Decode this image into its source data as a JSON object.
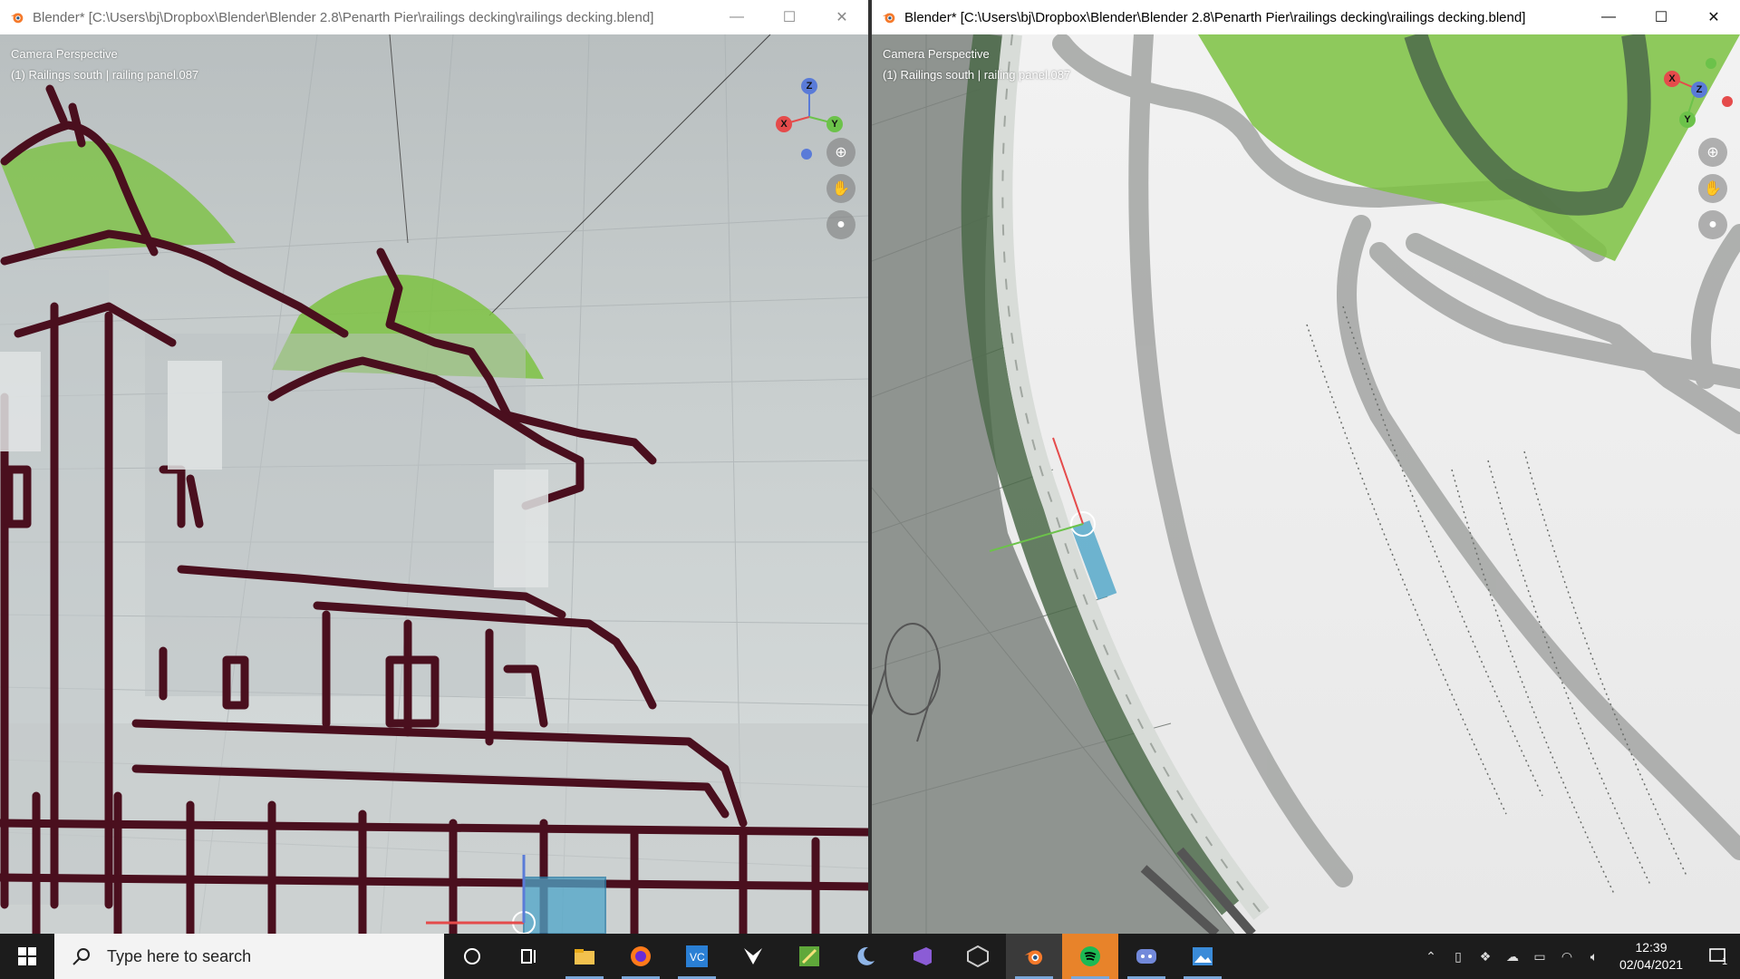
{
  "windows": [
    {
      "title": "Blender* [C:\\Users\\bj\\Dropbox\\Blender\\Blender 2.8\\Penarth Pier\\railings decking\\railings decking.blend]",
      "view_mode": "Camera Perspective",
      "selection_info": "(1) Railings south | railing panel.087",
      "minimize": "—",
      "maximize": "☐",
      "close": "✕"
    },
    {
      "title": "Blender* [C:\\Users\\bj\\Dropbox\\Blender\\Blender 2.8\\Penarth Pier\\railings decking\\railings decking.blend]",
      "view_mode": "Camera Perspective",
      "selection_info": "(1) Railings south | railing panel.087",
      "minimize": "—",
      "maximize": "☐",
      "close": "✕"
    }
  ],
  "gizmo_axes": {
    "x": "X",
    "y": "Y",
    "z": "Z"
  },
  "colors": {
    "stroke": "#4a0f1e",
    "green": "#7cc242",
    "gray_stroke": "#a3a5a3",
    "x_axis": "#e54b4b",
    "y_axis": "#6cc24a",
    "z_axis": "#5a7bd8"
  },
  "taskbar": {
    "search_placeholder": "Type here to search",
    "apps": [
      "cortana-icon",
      "task-view-icon",
      "file-explorer-icon",
      "firefox-icon",
      "vc-icon",
      "fox-app-icon",
      "green-app-icon",
      "moon-app-icon",
      "visual-studio-icon",
      "unity-icon",
      "blender-icon",
      "spotify-icon",
      "discord-icon",
      "photos-icon"
    ],
    "time": "12:39",
    "date": "02/04/2021",
    "notification_count": "1"
  }
}
